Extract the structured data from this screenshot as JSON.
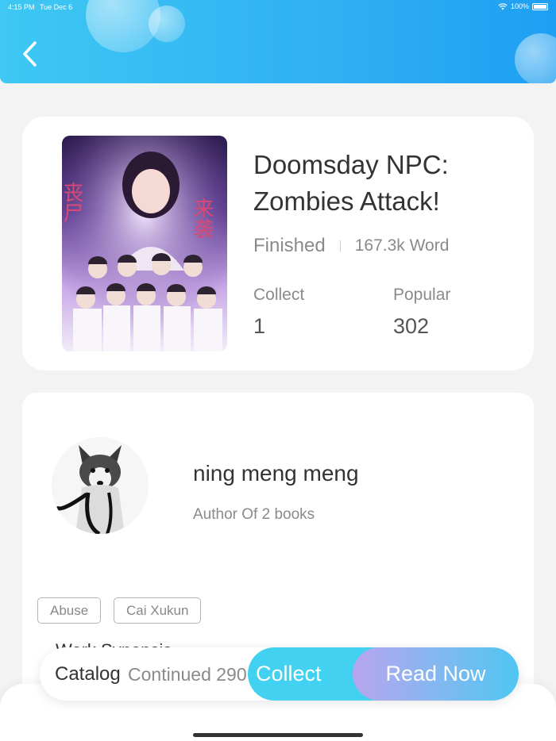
{
  "status_bar": {
    "time": "4:15 PM",
    "date": "Tue Dec 6",
    "battery": "100%"
  },
  "header": {
    "back_icon": "chevron-left-icon",
    "gradient_start": "#3ec8f3",
    "gradient_end": "#1e9ff2"
  },
  "book": {
    "title": "Doomsday NPC: Zombies Attack!",
    "status": "Finished",
    "word_count": "167.3k Word",
    "collect_label": "Collect",
    "collect_value": "1",
    "popular_label": "Popular",
    "popular_value": "302",
    "cover_text_left": "丧尸",
    "cover_text_right": "来袭"
  },
  "author": {
    "name": "ning meng meng",
    "books_info": "Author Of 2 books"
  },
  "tags": [
    "Abuse",
    "Cai Xukun"
  ],
  "synopsis_heading": "Work Synopsis",
  "action_bar": {
    "catalog_label": "Catalog",
    "continued_label": "Continued 290",
    "collect_button": "Collect",
    "read_button": "Read Now",
    "collect_color": "#43d1f1"
  }
}
